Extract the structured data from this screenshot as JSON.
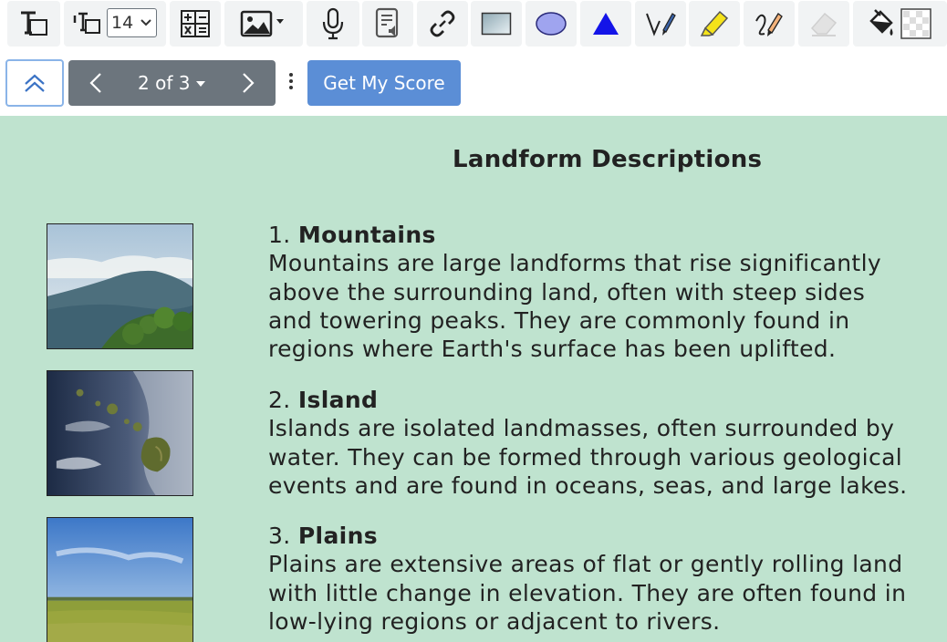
{
  "toolbar": {
    "font_size": "14",
    "tools": [
      "text-tool-icon",
      "text-size-icon",
      "calculator-icon",
      "image-icon",
      "microphone-icon",
      "audio-note-icon",
      "link-icon",
      "rectangle-icon",
      "ellipse-icon",
      "triangle-icon",
      "pen-icon",
      "highlighter-icon",
      "pencil-icon",
      "eraser-icon",
      "fill-bucket-icon"
    ],
    "colors": {
      "ellipse": "#9fa4ef",
      "triangle": "#1414e8",
      "highlighter": "#f5e31a"
    }
  },
  "nav": {
    "page_label": "2 of 3",
    "score_label": "Get My Score"
  },
  "content": {
    "title": "Landform Descriptions",
    "entries": [
      {
        "number": "1.",
        "name": "Mountains",
        "lines": [
          "Mountains are large landforms that rise significantly",
          "above the surrounding land, often with steep sides",
          "and towering peaks. They are commonly found in",
          "regions where Earth's surface has been uplifted."
        ]
      },
      {
        "number": "2.",
        "name": "Island",
        "lines": [
          "Islands are isolated landmasses, often surrounded by",
          "water. They can be formed through various geological",
          "events and are found in oceans, seas, and large lakes."
        ]
      },
      {
        "number": "3.",
        "name": "Plains",
        "lines": [
          "Plains are extensive areas of flat or gently rolling land",
          "with little change in elevation. They are often found in",
          "low-lying regions or adjacent to rivers."
        ]
      }
    ]
  }
}
